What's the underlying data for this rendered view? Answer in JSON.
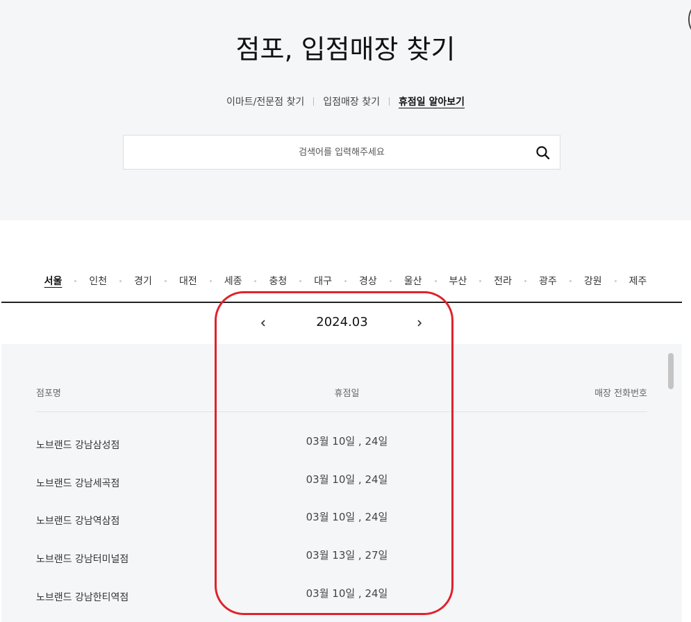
{
  "header": {
    "title": "점포, 입점매장 찾기"
  },
  "subnav": {
    "tabs": [
      {
        "label": "이마트/전문점 찾기"
      },
      {
        "label": "입점매장 찾기"
      },
      {
        "label": "휴점일 알아보기"
      }
    ],
    "active_index": 2
  },
  "search": {
    "placeholder": "검색어를 입력해주세요",
    "value": "",
    "button_icon": "search-icon"
  },
  "regions": {
    "items": [
      "서울",
      "인천",
      "경기",
      "대전",
      "세종",
      "충청",
      "대구",
      "경상",
      "울산",
      "부산",
      "전라",
      "광주",
      "강원",
      "제주"
    ],
    "active": "서울"
  },
  "calendar": {
    "month": "2024.03",
    "prev_icon": "chevron-left-icon",
    "next_icon": "chevron-right-icon"
  },
  "table": {
    "columns": [
      "점포명",
      "휴점일",
      "매장 전화번호"
    ],
    "rows": [
      {
        "name": "노브랜드 강남삼성점",
        "holiday": "03월 10일 , 24일"
      },
      {
        "name": "노브랜드 강남세곡점",
        "holiday": "03월 10일 , 24일"
      },
      {
        "name": "노브랜드 강남역삼점",
        "holiday": "03월 10일 , 24일"
      },
      {
        "name": "노브랜드 강남터미널점",
        "holiday": "03월 13일 , 27일"
      },
      {
        "name": "노브랜드 강남한티역점",
        "holiday": "03월 10일 , 24일"
      }
    ]
  },
  "colors": {
    "highlight": "#e0222a",
    "hero_bg": "#f5f6f8",
    "divider": "#222222"
  }
}
